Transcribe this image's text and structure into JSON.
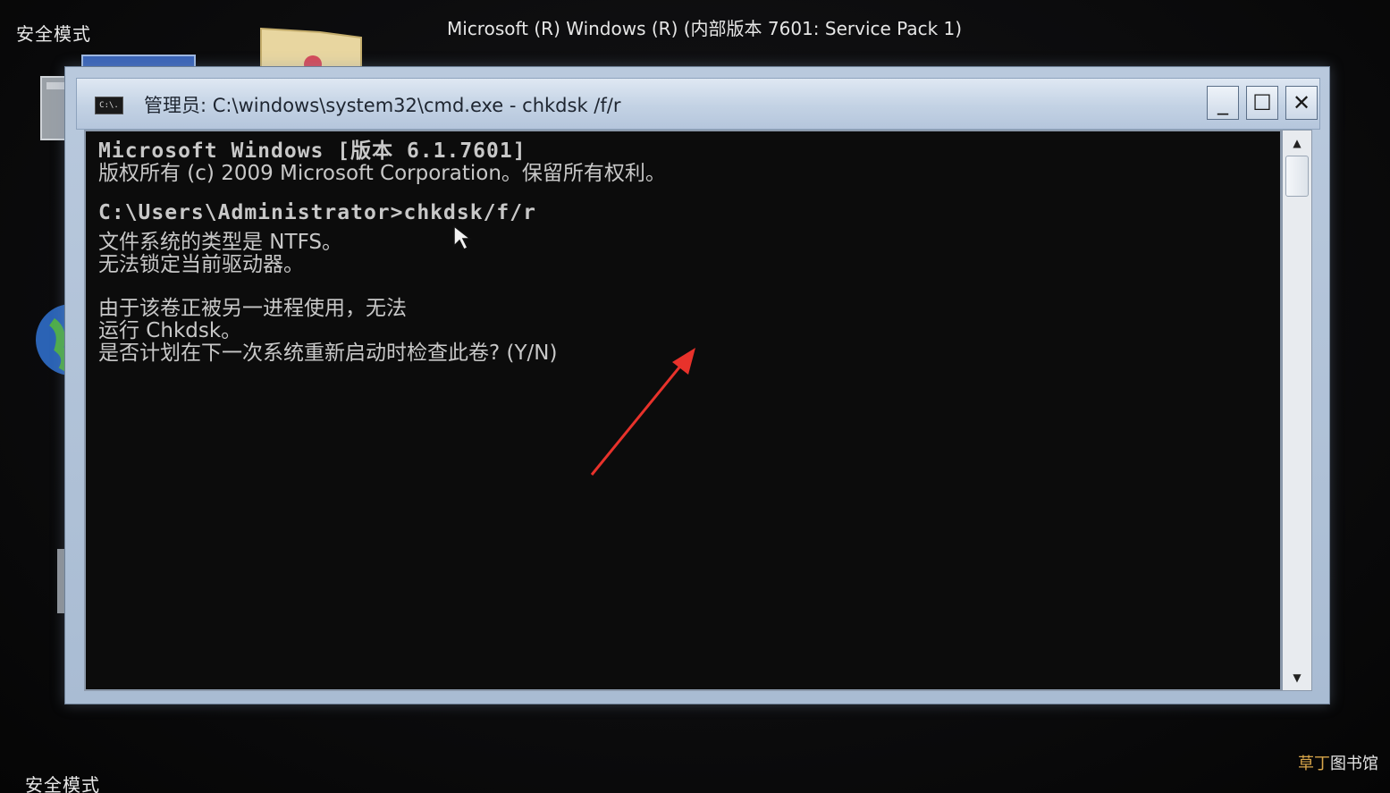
{
  "desktop": {
    "safe_mode_label_top": "安全模式",
    "safe_mode_label_bottom": "安全模式",
    "os_banner": "Microsoft (R) Windows (R) (内部版本 7601: Service Pack 1)"
  },
  "window": {
    "title": "管理员: C:\\windows\\system32\\cmd.exe - chkdsk /f/r",
    "icon_label": "C:\\.",
    "minimize_glyph": "_",
    "maximize_glyph": "☐",
    "close_glyph": "✕"
  },
  "console": {
    "lines": [
      "Microsoft Windows [版本 6.1.7601]",
      "版权所有 (c) 2009 Microsoft Corporation。保留所有权利。",
      "",
      "C:\\Users\\Administrator>chkdsk/f/r",
      "文件系统的类型是 NTFS。",
      "无法锁定当前驱动器。",
      "",
      "由于该卷正被另一进程使用，无法",
      "运行 Chkdsk。",
      "是否计划在下一次系统重新启动时检查此卷? (Y/N)"
    ]
  },
  "scrollbar": {
    "up_glyph": "▲",
    "down_glyph": "▼"
  },
  "watermark": {
    "brand_first": "草丁",
    "brand_rest": "图书馆"
  },
  "colors": {
    "console_bg": "#0c0c0c",
    "console_text": "#c8c8c8",
    "annotation_arrow": "#e8322b",
    "window_frame": "#b9c9dd"
  }
}
